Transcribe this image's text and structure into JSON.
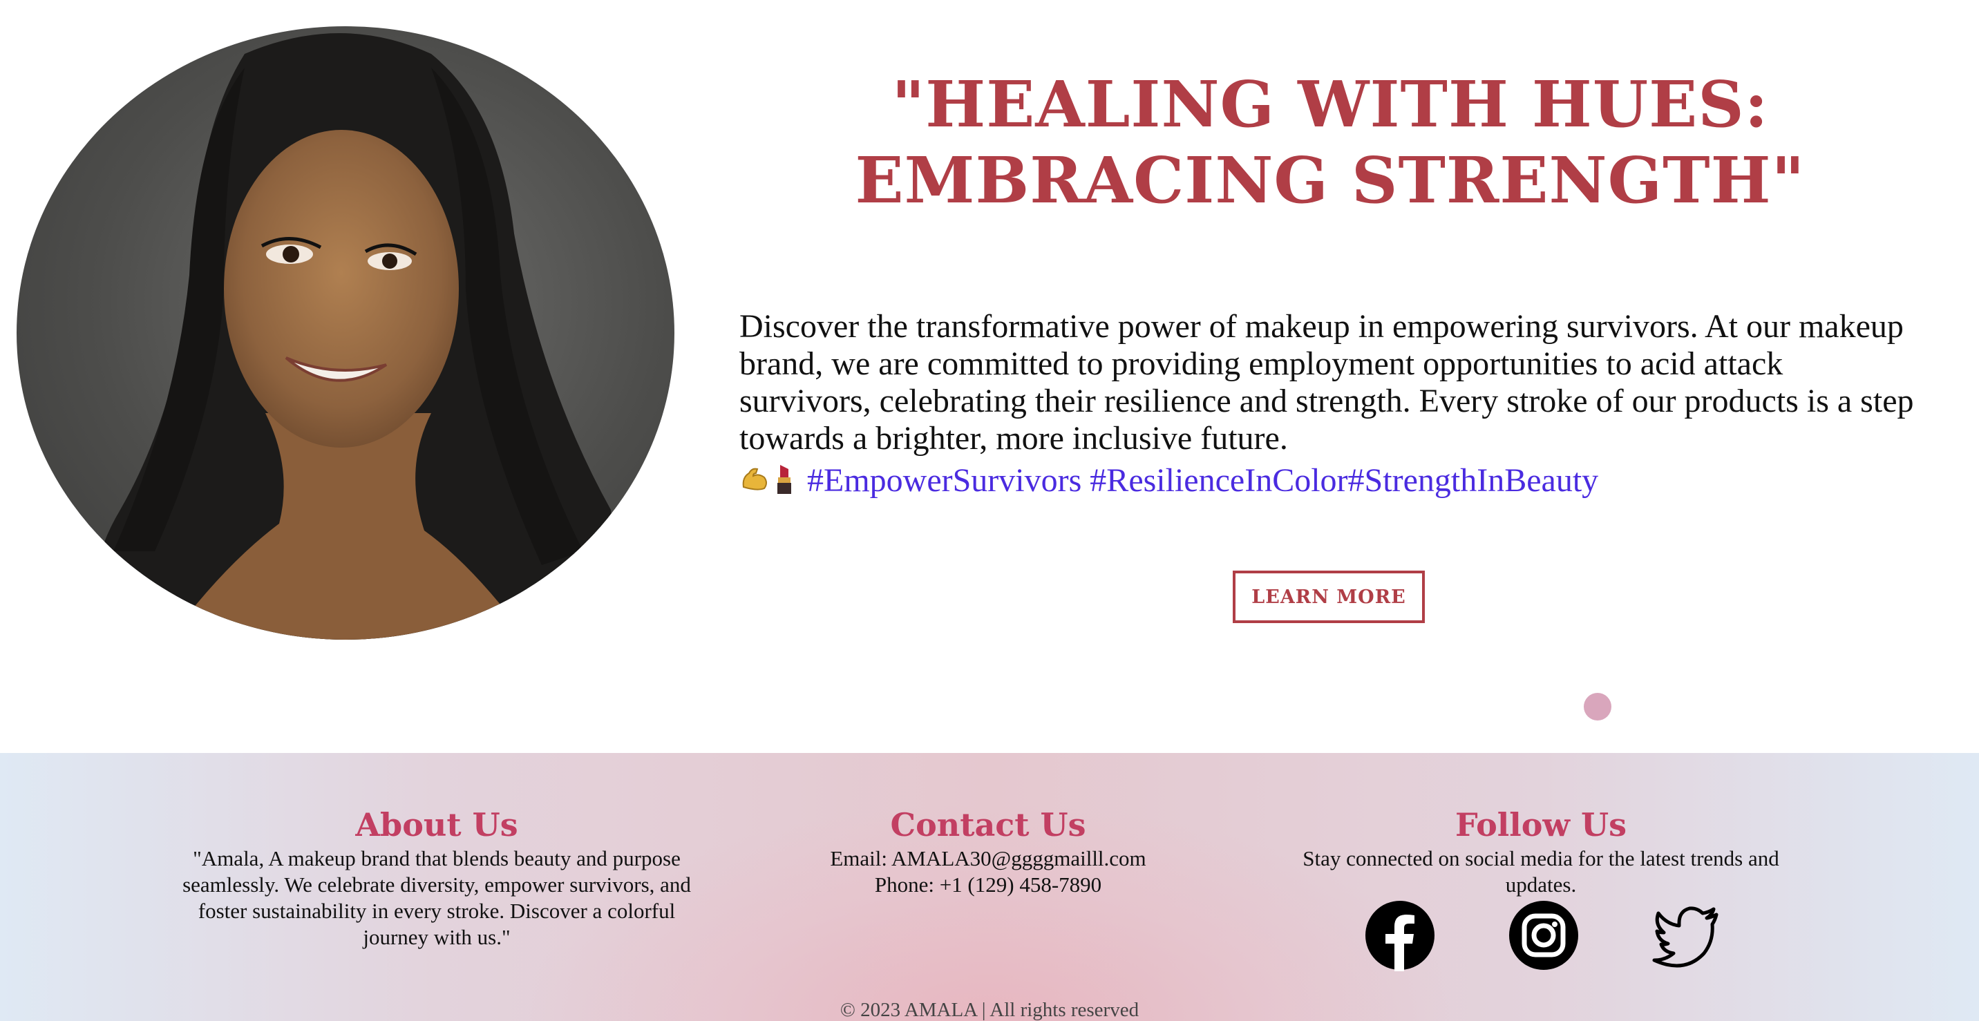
{
  "hero": {
    "headline_line1": "\"HEALING WITH HUES:",
    "headline_line2": "EMBRACING STRENGTH\"",
    "description": "Discover the transformative power of makeup in empowering survivors. At our makeup brand, we are committed to providing employment opportunities to acid attack survivors, celebrating their resilience and strength. Every stroke of our products is a step towards a brighter, more inclusive future.",
    "hashtag_emojis": [
      "flexed-biceps-icon",
      "lipstick-icon"
    ],
    "hashtags": [
      "#EmpowerSurvivors",
      "#ResilienceInColor",
      "#StrengthInBeauty"
    ],
    "cta_label": "LEARN MORE",
    "slider_dots": 1
  },
  "footer": {
    "about": {
      "title": "About Us",
      "text": "\"Amala, A makeup brand that blends beauty and purpose seamlessly. We celebrate diversity, empower survivors, and foster sustainability in every stroke. Discover a colorful journey with us.\""
    },
    "contact": {
      "title": "Contact Us",
      "email": "Email: AMALA30@ggggmailll.com",
      "phone": "Phone: +1 (129) 458-7890"
    },
    "follow": {
      "title": "Follow Us",
      "text": "Stay connected on social media for the latest trends and updates.",
      "icons": [
        "facebook-icon",
        "instagram-icon",
        "twitter-icon"
      ]
    },
    "copyright": "© 2023 AMALA | All rights reserved"
  },
  "colors": {
    "accent": "#b03e46",
    "footer_heading": "#c23f62",
    "hashtag": "#4a2be0",
    "slider_dot": "#d9a6bc"
  }
}
